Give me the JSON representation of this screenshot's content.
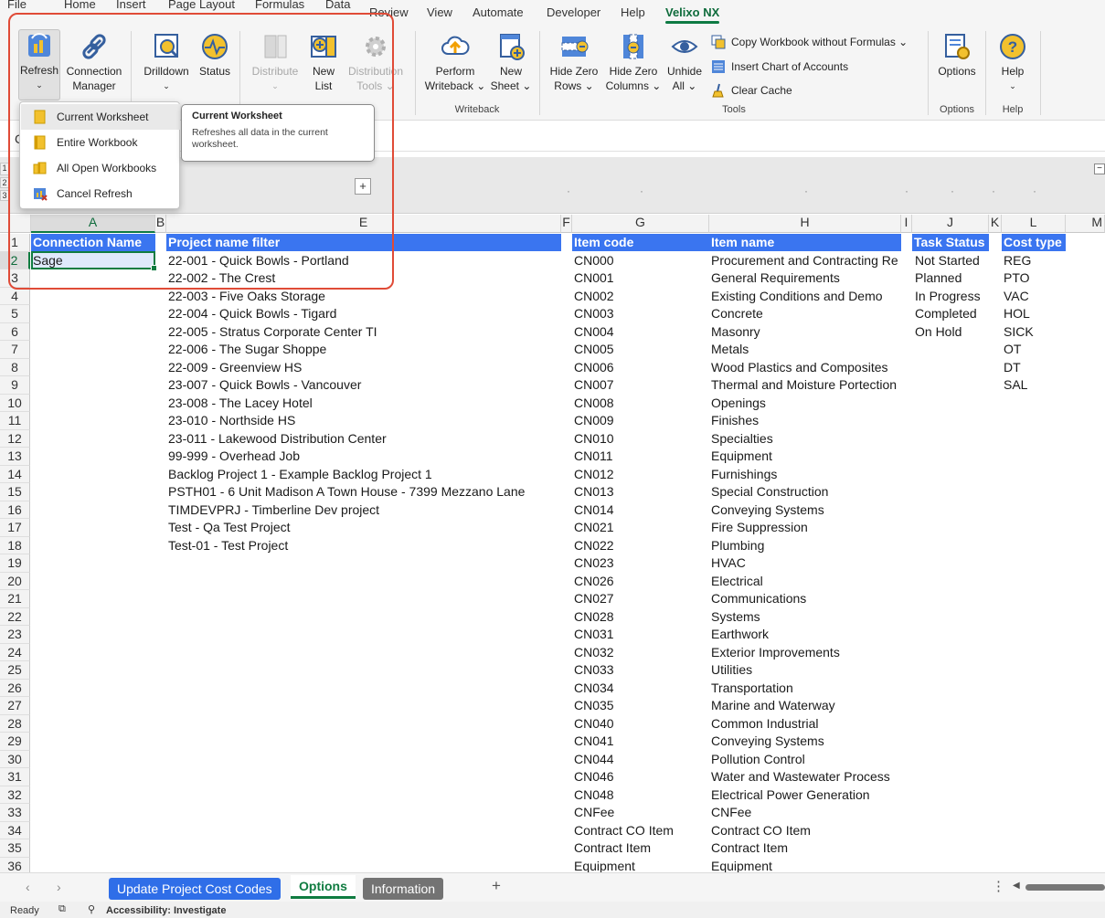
{
  "menu_tabs": [
    "File",
    "Home",
    "Insert",
    "Page Layout",
    "Formulas",
    "Data",
    "Review",
    "View",
    "Automate",
    "Developer",
    "Help",
    "Velixo NX"
  ],
  "active_tab": "Velixo NX",
  "ribbon": {
    "refresh": {
      "line1": "Refresh",
      "caret": "⌄"
    },
    "connection_manager": {
      "line1": "Connection",
      "line2": "Manager"
    },
    "drilldown": {
      "line1": "Drilldown",
      "caret": "⌄"
    },
    "status": {
      "line1": "Status"
    },
    "distribute": {
      "line1": "Distribute",
      "caret": "⌄"
    },
    "new_list": {
      "line1": "New",
      "line2": "List"
    },
    "distribution_tools": {
      "line1": "Distribution",
      "line2": "Tools ⌄"
    },
    "perform_writeback": {
      "line1": "Perform",
      "line2": "Writeback ⌄"
    },
    "new_sheet": {
      "line1": "New",
      "line2": "Sheet ⌄"
    },
    "hide_zero_rows": {
      "line1": "Hide Zero",
      "line2": "Rows ⌄"
    },
    "hide_zero_columns": {
      "line1": "Hide Zero",
      "line2": "Columns ⌄"
    },
    "unhide_all": {
      "line1": "Unhide",
      "line2": "All ⌄"
    },
    "copy_workbook": "Copy Workbook without Formulas ⌄",
    "insert_chart": "Insert Chart of Accounts",
    "clear_cache": "Clear Cache",
    "options": {
      "line1": "Options"
    },
    "help": {
      "line1": "Help",
      "caret": "⌄"
    },
    "groups": {
      "writeback": "Writeback",
      "tools": "Tools",
      "options": "Options",
      "help": "Help"
    }
  },
  "refresh_menu": {
    "items": [
      "Current Worksheet",
      "Entire Workbook",
      "All Open Workbooks",
      "Cancel Refresh"
    ]
  },
  "tooltip": {
    "title": "Current Worksheet",
    "body": "Refreshes all data in the current worksheet."
  },
  "name_box_fragment": "C",
  "outline_levels": [
    "1",
    "2",
    "3"
  ],
  "outline_plus": "+",
  "columns": [
    "A",
    "B",
    "E",
    "F",
    "G",
    "H",
    "I",
    "J",
    "K",
    "L",
    "M"
  ],
  "row_numbers": [
    "1",
    "2",
    "3",
    "4",
    "5",
    "6",
    "7",
    "8",
    "9",
    "10",
    "11",
    "12",
    "13",
    "14",
    "15",
    "16",
    "17",
    "18",
    "19",
    "20",
    "21",
    "22",
    "23",
    "24",
    "25",
    "26",
    "27",
    "28",
    "29",
    "30",
    "31",
    "32",
    "33",
    "34",
    "35",
    "36"
  ],
  "headers": {
    "connection_name": "Connection Name",
    "project_name_filter": "Project name filter",
    "item_code": "Item code",
    "item_name": "Item name",
    "task_status": "Task Status",
    "cost_type": "Cost type"
  },
  "connection_names": [
    "Sage"
  ],
  "projects": [
    "22-001 - Quick Bowls - Portland",
    "22-002 - The Crest",
    "22-003 - Five Oaks Storage",
    "22-004 - Quick Bowls - Tigard",
    "22-005 - Stratus Corporate Center TI",
    "22-006 - The Sugar Shoppe",
    "22-009 - Greenview HS",
    "23-007 - Quick Bowls - Vancouver",
    "23-008 - The Lacey Hotel",
    "23-010 - Northside HS",
    "23-011 - Lakewood Distribution Center",
    "99-999 - Overhead Job",
    "Backlog Project 1 - Example Backlog Project 1",
    "PSTH01 - 6 Unit Madison A Town House - 7399 Mezzano Lane",
    "TIMDEVPRJ - Timberline Dev project",
    "Test - Qa Test Project",
    "Test-01 - Test Project"
  ],
  "item_codes": [
    "CN000",
    "CN001",
    "CN002",
    "CN003",
    "CN004",
    "CN005",
    "CN006",
    "CN007",
    "CN008",
    "CN009",
    "CN010",
    "CN011",
    "CN012",
    "CN013",
    "CN014",
    "CN021",
    "CN022",
    "CN023",
    "CN026",
    "CN027",
    "CN028",
    "CN031",
    "CN032",
    "CN033",
    "CN034",
    "CN035",
    "CN040",
    "CN041",
    "CN044",
    "CN046",
    "CN048",
    "CNFee",
    "Contract CO Item",
    "Contract Item",
    "Equipment"
  ],
  "item_names": [
    "Procurement and Contracting Re",
    "General Requirements",
    "Existing Conditions and Demo",
    "Concrete",
    "Masonry",
    "Metals",
    "Wood Plastics and Composites",
    "Thermal and Moisture Portection",
    "Openings",
    "Finishes",
    "Specialties",
    "Equipment",
    "Furnishings",
    "Special Construction",
    "Conveying Systems",
    "Fire Suppression",
    "Plumbing",
    "HVAC",
    "Electrical",
    "Communications",
    "Systems",
    "Earthwork",
    "Exterior Improvements",
    "Utilities",
    "Transportation",
    "Marine and Waterway",
    "Common Industrial",
    "Conveying Systems",
    "Pollution Control",
    "Water and Wastewater Process",
    "Electrical Power Generation",
    "CNFee",
    "Contract CO Item",
    "Contract Item",
    "Equipment"
  ],
  "task_statuses": [
    "Not Started",
    "Planned",
    "In Progress",
    "Completed",
    "On Hold"
  ],
  "cost_types": [
    "REG",
    "PTO",
    "VAC",
    "HOL",
    "SICK",
    "OT",
    "DT",
    "SAL"
  ],
  "sheet_tabs": [
    {
      "label": "Update Project Cost Codes"
    },
    {
      "label": "Options"
    },
    {
      "label": "Information"
    }
  ],
  "add_sheet": "+",
  "status": {
    "ready": "Ready",
    "accessibility": "Accessibility: Investigate"
  },
  "colors": {
    "header_fill": "#3a75f0",
    "accent_green": "#107c41",
    "highlight_red": "#e04b37",
    "tab_blue": "#2f6ee8",
    "tab_gray": "#737373"
  }
}
